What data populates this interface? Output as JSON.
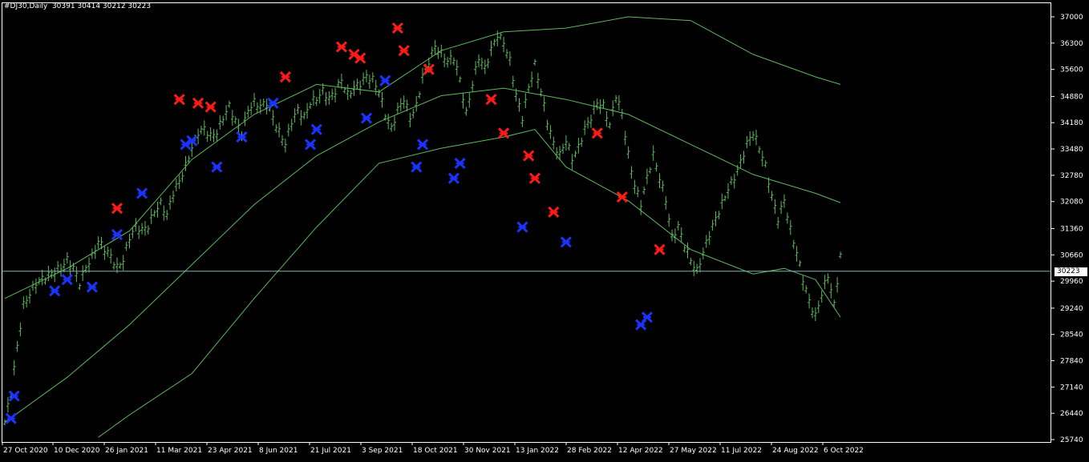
{
  "header": {
    "symbol": "#DJ30,Daily",
    "ohlc": "30391 30414 30212 30223"
  },
  "price_tag": "30223",
  "colors": {
    "background": "#000000",
    "bars": "#5cb85c",
    "bands": "#5cb85c",
    "axis": "#ffffff",
    "current_line": "#7fb2b2",
    "up_fractal": "#ff1a1a",
    "down_fractal": "#1a33ff"
  },
  "chart_data": {
    "type": "line",
    "instrument": "#DJ30",
    "timeframe": "Daily",
    "last": {
      "open": 30391,
      "high": 30414,
      "low": 30212,
      "close": 30223
    },
    "x_labels": [
      "27 Oct 2020",
      "10 Dec 2020",
      "26 Jan 2021",
      "11 Mar 2021",
      "23 Apr 2021",
      "8 Jun 2021",
      "21 Jul 2021",
      "3 Sep 2021",
      "18 Oct 2021",
      "30 Nov 2021",
      "13 Jan 2022",
      "28 Feb 2022",
      "12 Apr 2022",
      "27 May 2022",
      "11 Jul 2022",
      "24 Aug 2022",
      "6 Oct 2022"
    ],
    "y_ticks": [
      25740,
      26440,
      27140,
      27840,
      28540,
      29240,
      29960,
      30660,
      31360,
      32080,
      32780,
      33480,
      34180,
      34880,
      35600,
      36300,
      37000
    ],
    "ylim": [
      25740,
      37000
    ],
    "current_price": 30223,
    "bars_close": [
      [
        0,
        26200
      ],
      [
        2,
        27000
      ],
      [
        4,
        28200
      ],
      [
        6,
        29300
      ],
      [
        8,
        29600
      ],
      [
        10,
        29900
      ],
      [
        12,
        30000
      ],
      [
        14,
        30100
      ],
      [
        16,
        30200
      ],
      [
        18,
        30300
      ],
      [
        20,
        30500
      ],
      [
        22,
        30300
      ],
      [
        24,
        29900
      ],
      [
        26,
        30300
      ],
      [
        28,
        30600
      ],
      [
        30,
        31000
      ],
      [
        32,
        30800
      ],
      [
        34,
        30600
      ],
      [
        36,
        30300
      ],
      [
        38,
        30500
      ],
      [
        40,
        31100
      ],
      [
        42,
        31400
      ],
      [
        44,
        31300
      ],
      [
        46,
        31400
      ],
      [
        48,
        31800
      ],
      [
        50,
        32000
      ],
      [
        52,
        31700
      ],
      [
        54,
        32300
      ],
      [
        56,
        32600
      ],
      [
        58,
        33000
      ],
      [
        60,
        33500
      ],
      [
        62,
        33900
      ],
      [
        64,
        34000
      ],
      [
        66,
        33800
      ],
      [
        68,
        33900
      ],
      [
        70,
        34300
      ],
      [
        72,
        34600
      ],
      [
        74,
        34200
      ],
      [
        76,
        33900
      ],
      [
        78,
        34500
      ],
      [
        80,
        34700
      ],
      [
        82,
        34600
      ],
      [
        84,
        34700
      ],
      [
        86,
        34300
      ],
      [
        88,
        33900
      ],
      [
        90,
        33600
      ],
      [
        92,
        34200
      ],
      [
        94,
        34500
      ],
      [
        96,
        34300
      ],
      [
        98,
        34700
      ],
      [
        100,
        34800
      ],
      [
        102,
        35000
      ],
      [
        104,
        34800
      ],
      [
        106,
        35000
      ],
      [
        108,
        35300
      ],
      [
        110,
        34900
      ],
      [
        112,
        35100
      ],
      [
        114,
        35200
      ],
      [
        116,
        35400
      ],
      [
        118,
        35300
      ],
      [
        120,
        35000
      ],
      [
        122,
        34400
      ],
      [
        124,
        34000
      ],
      [
        126,
        34500
      ],
      [
        128,
        34800
      ],
      [
        130,
        34300
      ],
      [
        132,
        34600
      ],
      [
        134,
        35400
      ],
      [
        136,
        35800
      ],
      [
        138,
        36200
      ],
      [
        140,
        36000
      ],
      [
        142,
        35800
      ],
      [
        144,
        35900
      ],
      [
        146,
        35300
      ],
      [
        148,
        34400
      ],
      [
        150,
        35200
      ],
      [
        152,
        35900
      ],
      [
        154,
        35600
      ],
      [
        156,
        36100
      ],
      [
        158,
        36500
      ],
      [
        160,
        36300
      ],
      [
        162,
        35800
      ],
      [
        164,
        34900
      ],
      [
        166,
        34300
      ],
      [
        168,
        35100
      ],
      [
        170,
        35700
      ],
      [
        172,
        35000
      ],
      [
        174,
        34200
      ],
      [
        176,
        33600
      ],
      [
        178,
        33300
      ],
      [
        180,
        33700
      ],
      [
        182,
        33200
      ],
      [
        184,
        33500
      ],
      [
        186,
        34000
      ],
      [
        188,
        34300
      ],
      [
        190,
        34700
      ],
      [
        192,
        34600
      ],
      [
        194,
        34100
      ],
      [
        196,
        34900
      ],
      [
        198,
        34400
      ],
      [
        200,
        33300
      ],
      [
        202,
        32500
      ],
      [
        204,
        32000
      ],
      [
        206,
        32700
      ],
      [
        208,
        33300
      ],
      [
        210,
        32700
      ],
      [
        212,
        32100
      ],
      [
        214,
        31100
      ],
      [
        216,
        31400
      ],
      [
        218,
        30900
      ],
      [
        220,
        30500
      ],
      [
        222,
        30200
      ],
      [
        224,
        30700
      ],
      [
        226,
        31200
      ],
      [
        228,
        31600
      ],
      [
        230,
        32000
      ],
      [
        232,
        32400
      ],
      [
        234,
        32700
      ],
      [
        236,
        33100
      ],
      [
        238,
        33600
      ],
      [
        240,
        33900
      ],
      [
        242,
        33500
      ],
      [
        244,
        33000
      ],
      [
        246,
        32200
      ],
      [
        248,
        31600
      ],
      [
        250,
        32100
      ],
      [
        252,
        31300
      ],
      [
        254,
        30700
      ],
      [
        256,
        30000
      ],
      [
        258,
        29400
      ],
      [
        260,
        29000
      ],
      [
        262,
        29600
      ],
      [
        264,
        30100
      ],
      [
        266,
        29300
      ],
      [
        268,
        30600
      ]
    ],
    "series": [
      {
        "name": "",
        "role": "upper-band",
        "x": [
          0,
          20,
          40,
          60,
          80,
          100,
          120,
          140,
          160,
          180,
          200,
          220,
          240,
          260,
          268
        ],
        "y": [
          29500,
          30300,
          31300,
          33200,
          34400,
          35200,
          35000,
          36100,
          36600,
          36700,
          37000,
          36900,
          36000,
          35400,
          35200
        ]
      },
      {
        "name": "",
        "role": "middle-band",
        "x": [
          0,
          20,
          40,
          60,
          80,
          100,
          120,
          140,
          160,
          180,
          200,
          220,
          240,
          260,
          268
        ],
        "y": [
          26200,
          27400,
          28800,
          30400,
          32000,
          33300,
          34200,
          34900,
          35100,
          34800,
          34400,
          33600,
          32800,
          32300,
          32050
        ]
      },
      {
        "name": "",
        "role": "lower-band",
        "x": [
          30,
          40,
          60,
          80,
          100,
          120,
          140,
          160,
          170,
          180,
          200,
          220,
          240,
          250,
          260,
          268
        ],
        "y": [
          25800,
          26400,
          27500,
          29500,
          31400,
          33100,
          33500,
          33800,
          34000,
          33000,
          32100,
          30800,
          30150,
          30300,
          30000,
          29000
        ]
      }
    ],
    "fractals_up": [
      [
        36,
        31900
      ],
      [
        56,
        34800
      ],
      [
        62,
        34700
      ],
      [
        66,
        34600
      ],
      [
        90,
        35400
      ],
      [
        108,
        36200
      ],
      [
        112,
        36000
      ],
      [
        114,
        35900
      ],
      [
        126,
        36700
      ],
      [
        128,
        36100
      ],
      [
        136,
        35600
      ],
      [
        156,
        34800
      ],
      [
        160,
        33900
      ],
      [
        168,
        33300
      ],
      [
        170,
        32700
      ],
      [
        176,
        31800
      ],
      [
        190,
        33900
      ],
      [
        198,
        32200
      ],
      [
        210,
        30800
      ]
    ],
    "fractals_down": [
      [
        2,
        26300
      ],
      [
        3,
        26900
      ],
      [
        16,
        29700
      ],
      [
        20,
        30000
      ],
      [
        28,
        29800
      ],
      [
        36,
        31200
      ],
      [
        44,
        32300
      ],
      [
        58,
        33600
      ],
      [
        60,
        33700
      ],
      [
        68,
        33000
      ],
      [
        76,
        33800
      ],
      [
        86,
        34700
      ],
      [
        98,
        33600
      ],
      [
        100,
        34000
      ],
      [
        116,
        34300
      ],
      [
        122,
        35300
      ],
      [
        132,
        33000
      ],
      [
        134,
        33600
      ],
      [
        144,
        32700
      ],
      [
        146,
        33100
      ],
      [
        166,
        31400
      ],
      [
        180,
        31000
      ],
      [
        204,
        28800
      ],
      [
        206,
        29000
      ]
    ]
  }
}
